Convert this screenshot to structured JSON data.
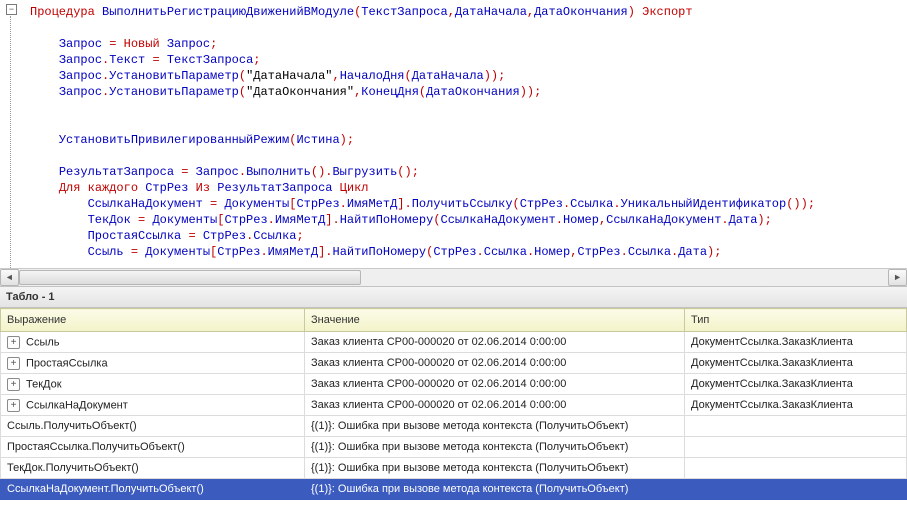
{
  "editor": {
    "tokens": [
      [
        [
          "kw",
          "Процедура"
        ],
        [
          "",
          " "
        ],
        [
          "id",
          "ВыполнитьРегистрациюДвиженийВМодуле"
        ],
        [
          "kw",
          "("
        ],
        [
          "id",
          "ТекстЗапроса"
        ],
        [
          "kw",
          ","
        ],
        [
          "id",
          "ДатаНачала"
        ],
        [
          "kw",
          ","
        ],
        [
          "id",
          "ДатаОкончания"
        ],
        [
          "kw",
          ")"
        ],
        [
          "",
          " "
        ],
        [
          "kw",
          "Экспорт"
        ]
      ],
      [],
      [
        [
          "",
          "    "
        ],
        [
          "id",
          "Запрос"
        ],
        [
          "",
          " "
        ],
        [
          "kw",
          "="
        ],
        [
          "",
          " "
        ],
        [
          "kw",
          "Новый"
        ],
        [
          "",
          " "
        ],
        [
          "id",
          "Запрос"
        ],
        [
          "kw",
          ";"
        ]
      ],
      [
        [
          "",
          "    "
        ],
        [
          "id",
          "Запрос"
        ],
        [
          "kw",
          "."
        ],
        [
          "id",
          "Текст"
        ],
        [
          "",
          " "
        ],
        [
          "kw",
          "="
        ],
        [
          "",
          " "
        ],
        [
          "id",
          "ТекстЗапроса"
        ],
        [
          "kw",
          ";"
        ]
      ],
      [
        [
          "",
          "    "
        ],
        [
          "id",
          "Запрос"
        ],
        [
          "kw",
          "."
        ],
        [
          "id",
          "УстановитьПараметр"
        ],
        [
          "kw",
          "("
        ],
        [
          "str",
          "\"ДатаНачала\""
        ],
        [
          "kw",
          ","
        ],
        [
          "id",
          "НачалоДня"
        ],
        [
          "kw",
          "("
        ],
        [
          "id",
          "ДатаНачала"
        ],
        [
          "kw",
          "));"
        ]
      ],
      [
        [
          "",
          "    "
        ],
        [
          "id",
          "Запрос"
        ],
        [
          "kw",
          "."
        ],
        [
          "id",
          "УстановитьПараметр"
        ],
        [
          "kw",
          "("
        ],
        [
          "str",
          "\"ДатаОкончания\""
        ],
        [
          "kw",
          ","
        ],
        [
          "id",
          "КонецДня"
        ],
        [
          "kw",
          "("
        ],
        [
          "id",
          "ДатаОкончания"
        ],
        [
          "kw",
          "));"
        ]
      ],
      [],
      [],
      [
        [
          "",
          "    "
        ],
        [
          "id",
          "УстановитьПривилегированныйРежим"
        ],
        [
          "kw",
          "("
        ],
        [
          "id",
          "Истина"
        ],
        [
          "kw",
          ");"
        ]
      ],
      [],
      [
        [
          "",
          "    "
        ],
        [
          "id",
          "РезультатЗапроса"
        ],
        [
          "",
          " "
        ],
        [
          "kw",
          "="
        ],
        [
          "",
          " "
        ],
        [
          "id",
          "Запрос"
        ],
        [
          "kw",
          "."
        ],
        [
          "id",
          "Выполнить"
        ],
        [
          "kw",
          "()."
        ],
        [
          "id",
          "Выгрузить"
        ],
        [
          "kw",
          "();"
        ]
      ],
      [
        [
          "",
          "    "
        ],
        [
          "kw",
          "Для каждого"
        ],
        [
          "",
          " "
        ],
        [
          "id",
          "СтрРез"
        ],
        [
          "",
          " "
        ],
        [
          "kw",
          "Из"
        ],
        [
          "",
          " "
        ],
        [
          "id",
          "РезультатЗапроса"
        ],
        [
          "",
          " "
        ],
        [
          "kw",
          "Цикл"
        ]
      ],
      [
        [
          "",
          "        "
        ],
        [
          "id",
          "СсылкаНаДокумент"
        ],
        [
          "",
          " "
        ],
        [
          "kw",
          "="
        ],
        [
          "",
          " "
        ],
        [
          "id",
          "Документы"
        ],
        [
          "kw",
          "["
        ],
        [
          "id",
          "СтрРез"
        ],
        [
          "kw",
          "."
        ],
        [
          "id",
          "ИмяМетД"
        ],
        [
          "kw",
          "]."
        ],
        [
          "id",
          "ПолучитьСсылку"
        ],
        [
          "kw",
          "("
        ],
        [
          "id",
          "СтрРез"
        ],
        [
          "kw",
          "."
        ],
        [
          "id",
          "Ссылка"
        ],
        [
          "kw",
          "."
        ],
        [
          "id",
          "УникальныйИдентификатор"
        ],
        [
          "kw",
          "());"
        ]
      ],
      [
        [
          "",
          "        "
        ],
        [
          "id",
          "ТекДок"
        ],
        [
          "",
          " "
        ],
        [
          "kw",
          "="
        ],
        [
          "",
          " "
        ],
        [
          "id",
          "Документы"
        ],
        [
          "kw",
          "["
        ],
        [
          "id",
          "СтрРез"
        ],
        [
          "kw",
          "."
        ],
        [
          "id",
          "ИмяМетД"
        ],
        [
          "kw",
          "]."
        ],
        [
          "id",
          "НайтиПоНомеру"
        ],
        [
          "kw",
          "("
        ],
        [
          "id",
          "СсылкаНаДокумент"
        ],
        [
          "kw",
          "."
        ],
        [
          "id",
          "Номер"
        ],
        [
          "kw",
          ","
        ],
        [
          "id",
          "СсылкаНаДокумент"
        ],
        [
          "kw",
          "."
        ],
        [
          "id",
          "Дата"
        ],
        [
          "kw",
          ");"
        ]
      ],
      [
        [
          "",
          "        "
        ],
        [
          "id",
          "ПростаяСсылка"
        ],
        [
          "",
          " "
        ],
        [
          "kw",
          "="
        ],
        [
          "",
          " "
        ],
        [
          "id",
          "СтрРез"
        ],
        [
          "kw",
          "."
        ],
        [
          "id",
          "Ссылка"
        ],
        [
          "kw",
          ";"
        ]
      ],
      [
        [
          "",
          "        "
        ],
        [
          "id",
          "Ссыль"
        ],
        [
          "",
          " "
        ],
        [
          "kw",
          "="
        ],
        [
          "",
          " "
        ],
        [
          "id",
          "Документы"
        ],
        [
          "kw",
          "["
        ],
        [
          "id",
          "СтрРез"
        ],
        [
          "kw",
          "."
        ],
        [
          "id",
          "ИмяМетД"
        ],
        [
          "kw",
          "]."
        ],
        [
          "id",
          "НайтиПоНомеру"
        ],
        [
          "kw",
          "("
        ],
        [
          "id",
          "СтрРез"
        ],
        [
          "kw",
          "."
        ],
        [
          "id",
          "Ссылка"
        ],
        [
          "kw",
          "."
        ],
        [
          "id",
          "Номер"
        ],
        [
          "kw",
          ","
        ],
        [
          "id",
          "СтрРез"
        ],
        [
          "kw",
          "."
        ],
        [
          "id",
          "Ссылка"
        ],
        [
          "kw",
          "."
        ],
        [
          "id",
          "Дата"
        ],
        [
          "kw",
          ");"
        ]
      ]
    ]
  },
  "panel": {
    "title": "Табло - 1"
  },
  "grid": {
    "columns": [
      "Выражение",
      "Значение",
      "Тип"
    ],
    "rows": [
      {
        "expand": true,
        "expr": "Ссыль",
        "val": "Заказ клиента СР00-000020 от 02.06.2014 0:00:00",
        "type": "ДокументСсылка.ЗаказКлиента",
        "sel": false
      },
      {
        "expand": true,
        "expr": "ПростаяСсылка",
        "val": "Заказ клиента СР00-000020 от 02.06.2014 0:00:00",
        "type": "ДокументСсылка.ЗаказКлиента",
        "sel": false
      },
      {
        "expand": true,
        "expr": "ТекДок",
        "val": "Заказ клиента СР00-000020 от 02.06.2014 0:00:00",
        "type": "ДокументСсылка.ЗаказКлиента",
        "sel": false
      },
      {
        "expand": true,
        "expr": "СсылкаНаДокумент",
        "val": "Заказ клиента СР00-000020 от 02.06.2014 0:00:00",
        "type": "ДокументСсылка.ЗаказКлиента",
        "sel": false
      },
      {
        "expand": false,
        "expr": "Ссыль.ПолучитьОбъект()",
        "val": "{(1)}: Ошибка при вызове метода контекста (ПолучитьОбъект)",
        "type": "",
        "sel": false
      },
      {
        "expand": false,
        "expr": "ПростаяСсылка.ПолучитьОбъект()",
        "val": "{(1)}: Ошибка при вызове метода контекста (ПолучитьОбъект)",
        "type": "",
        "sel": false
      },
      {
        "expand": false,
        "expr": "ТекДок.ПолучитьОбъект()",
        "val": "{(1)}: Ошибка при вызове метода контекста (ПолучитьОбъект)",
        "type": "",
        "sel": false
      },
      {
        "expand": false,
        "expr": "СсылкаНаДокумент.ПолучитьОбъект()",
        "val": "{(1)}: Ошибка при вызове метода контекста (ПолучитьОбъект)",
        "type": "",
        "sel": true
      }
    ]
  }
}
